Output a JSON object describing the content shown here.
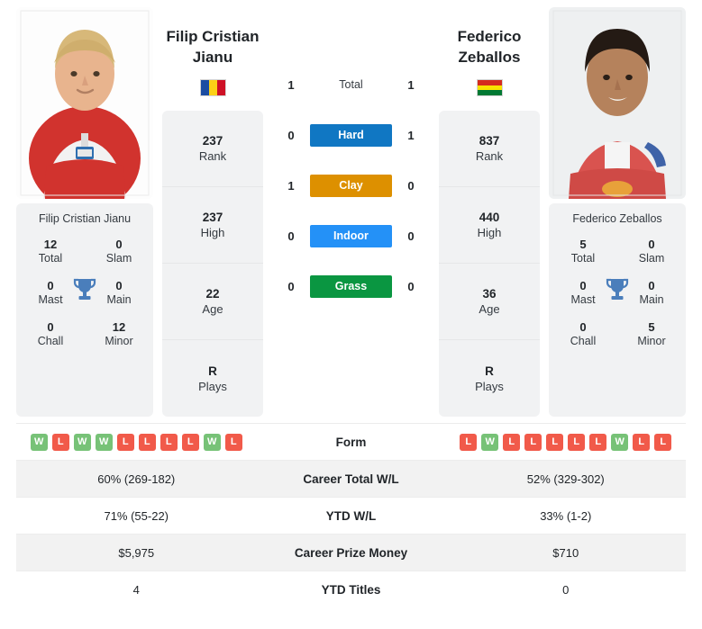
{
  "colors": {
    "hard": "#1077c3",
    "clay": "#dd9000",
    "indoor": "#2491f7",
    "grass": "#0a9641",
    "win": "#77c277",
    "loss": "#f15a4a",
    "card_bg": "#f1f2f3",
    "row_alt": "#f2f2f2"
  },
  "players": {
    "left": {
      "display_name_line1": "Filip Cristian",
      "display_name_line2": "Jianu",
      "full_name": "Filip Cristian Jianu",
      "country": "Romania",
      "flag_colors": [
        "#1b4da2",
        "#fcd116",
        "#ce1126"
      ],
      "flag_orientation": "vertical",
      "stats": [
        {
          "value": "237",
          "label": "Rank"
        },
        {
          "value": "237",
          "label": "High"
        },
        {
          "value": "22",
          "label": "Age"
        },
        {
          "value": "R",
          "label": "Plays"
        }
      ],
      "titles": [
        {
          "value": "12",
          "label": "Total"
        },
        {
          "value": "0",
          "label": "Slam"
        },
        {
          "value": "0",
          "label": "Mast"
        },
        {
          "value": "0",
          "label": "Main"
        },
        {
          "value": "0",
          "label": "Chall"
        },
        {
          "value": "12",
          "label": "Minor"
        }
      ],
      "form": [
        "W",
        "L",
        "W",
        "W",
        "L",
        "L",
        "L",
        "L",
        "W",
        "L"
      ],
      "career_total_wl": "60% (269-182)",
      "ytd_wl": "71% (55-22)",
      "career_prize_money": "$5,975",
      "ytd_titles": "4"
    },
    "right": {
      "display_name_line1": "Federico",
      "display_name_line2": "Zeballos",
      "full_name": "Federico Zeballos",
      "country": "Bolivia",
      "flag_colors": [
        "#d52b1e",
        "#f9e300",
        "#007934"
      ],
      "flag_orientation": "horizontal",
      "stats": [
        {
          "value": "837",
          "label": "Rank"
        },
        {
          "value": "440",
          "label": "High"
        },
        {
          "value": "36",
          "label": "Age"
        },
        {
          "value": "R",
          "label": "Plays"
        }
      ],
      "titles": [
        {
          "value": "5",
          "label": "Total"
        },
        {
          "value": "0",
          "label": "Slam"
        },
        {
          "value": "0",
          "label": "Mast"
        },
        {
          "value": "0",
          "label": "Main"
        },
        {
          "value": "0",
          "label": "Chall"
        },
        {
          "value": "5",
          "label": "Minor"
        }
      ],
      "form": [
        "L",
        "W",
        "L",
        "L",
        "L",
        "L",
        "L",
        "W",
        "L",
        "L"
      ],
      "career_total_wl": "52% (329-302)",
      "ytd_wl": "33% (1-2)",
      "career_prize_money": "$710",
      "ytd_titles": "0"
    }
  },
  "head_to_head": [
    {
      "key": "total",
      "label": "Total",
      "left": "1",
      "right": "1",
      "bar": false
    },
    {
      "key": "hard",
      "label": "Hard",
      "left": "0",
      "right": "1",
      "bar": true,
      "color": "#1077c3"
    },
    {
      "key": "clay",
      "label": "Clay",
      "left": "1",
      "right": "0",
      "bar": true,
      "color": "#dd9000"
    },
    {
      "key": "indoor",
      "label": "Indoor",
      "left": "0",
      "right": "0",
      "bar": true,
      "color": "#2491f7"
    },
    {
      "key": "grass",
      "label": "Grass",
      "left": "0",
      "right": "0",
      "bar": true,
      "color": "#0a9641"
    }
  ],
  "table": {
    "rows": [
      {
        "label": "Form",
        "type": "form"
      },
      {
        "label": "Career Total W/L",
        "left": "60% (269-182)",
        "right": "52% (329-302)"
      },
      {
        "label": "YTD W/L",
        "left": "71% (55-22)",
        "right": "33% (1-2)"
      },
      {
        "label": "Career Prize Money",
        "left": "$5,975",
        "right": "$710"
      },
      {
        "label": "YTD Titles",
        "left": "4",
        "right": "0"
      }
    ]
  }
}
